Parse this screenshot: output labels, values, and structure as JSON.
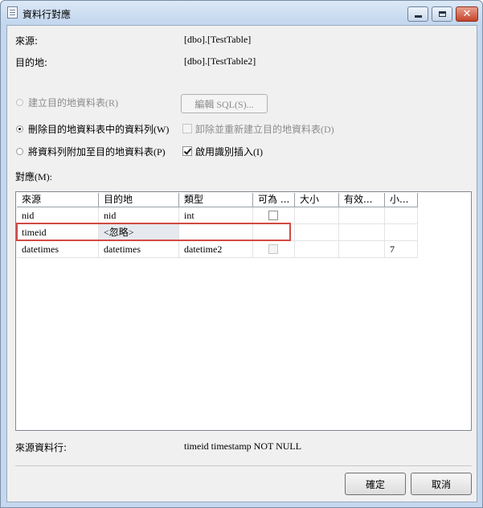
{
  "window": {
    "title": "資料行對應",
    "close_glyph": "✕"
  },
  "source": {
    "label": "來源:",
    "value": "[dbo].[TestTable]"
  },
  "destination": {
    "label": "目的地:",
    "value": "[dbo].[TestTable2]"
  },
  "options": {
    "create_table": {
      "label": "建立目的地資料表(R)",
      "selected": false,
      "enabled": false
    },
    "edit_sql_button": "編輯 SQL(S)...",
    "delete_rows": {
      "label": "刪除目的地資料表中的資料列(W)",
      "selected": true
    },
    "drop_recreate": {
      "label": "卸除並重新建立目的地資料表(D)",
      "checked": false,
      "enabled": false
    },
    "append_rows": {
      "label": "將資料列附加至目的地資料表(P)",
      "selected": false
    },
    "identity_insert": {
      "label": "啟用識別插入(I)",
      "checked": true
    }
  },
  "mappings": {
    "label": "對應(M):",
    "columns": [
      "來源",
      "目的地",
      "類型",
      "可為 ...",
      "大小",
      "有效...",
      "小..."
    ],
    "rows": [
      {
        "source": "nid",
        "destination": "nid",
        "type": "int",
        "nullable": false,
        "size": "",
        "precision": "",
        "scale": ""
      },
      {
        "source": "timeid",
        "destination": "<忽略>",
        "type": "",
        "nullable": null,
        "size": "",
        "precision": "",
        "scale": ""
      },
      {
        "source": "datetimes",
        "destination": "datetimes",
        "type": "datetime2",
        "nullable": false,
        "size": "",
        "precision": "",
        "scale": "7"
      }
    ]
  },
  "source_column": {
    "label": "來源資料行:",
    "value": "timeid timestamp NOT NULL"
  },
  "buttons": {
    "ok": "確定",
    "cancel": "取消"
  },
  "colors": {
    "highlight_box": "#d24a44",
    "close_button": "#c4432a"
  }
}
